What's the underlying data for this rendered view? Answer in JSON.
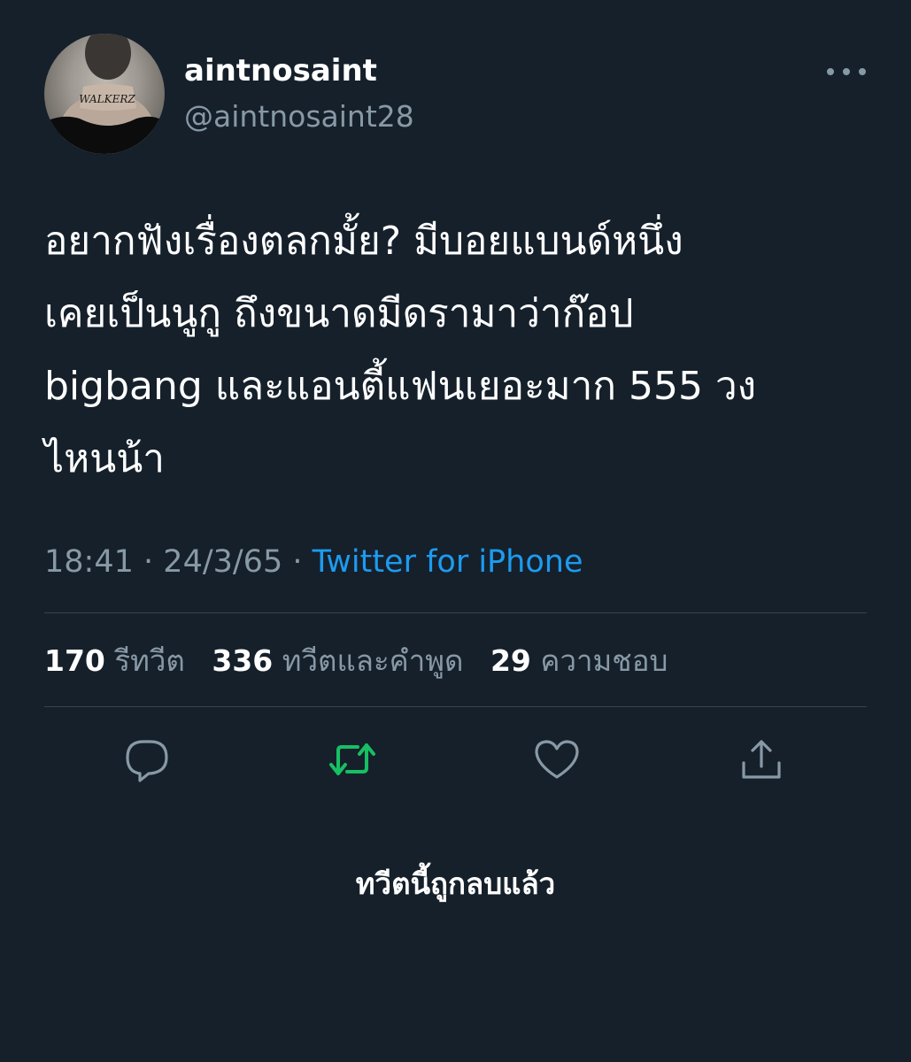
{
  "user": {
    "display_name": "aintnosaint",
    "handle": "@aintnosaint28",
    "avatar_tattoo_text": "WALKERZ"
  },
  "tweet": {
    "text": "อยากฟังเรื่องตลกมั้ย? มีบอยแบนด์หนึ่ง\nเคยเป็นนูกู ถึงขนาดมีดรามาว่าก๊อป\nbigbang และแอนตี้แฟนเยอะมาก 555 วง\nไหนน้า",
    "time": "18:41",
    "separator": "·",
    "date": "24/3/65",
    "source": "Twitter for iPhone"
  },
  "stats": {
    "retweets_count": "170",
    "retweets_label": "รีทวีต",
    "quotes_count": "336",
    "quotes_label": "ทวีตและคำพูด",
    "likes_count": "29",
    "likes_label": "ความชอบ"
  },
  "actions": {
    "reply_icon": "reply-icon",
    "retweet_icon": "retweet-icon",
    "like_icon": "heart-icon",
    "share_icon": "share-icon"
  },
  "notice": {
    "deleted_text": "ทวีตนี้ถูกลบแล้ว"
  },
  "colors": {
    "background": "#15202b",
    "secondary_text": "#8899a6",
    "link": "#1d9bf0",
    "retweet_active": "#17bf63",
    "divider": "#38444d"
  }
}
